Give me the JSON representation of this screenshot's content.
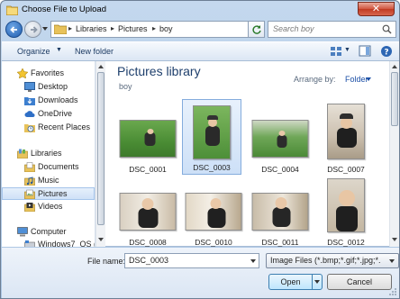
{
  "window": {
    "title": "Choose File to Upload",
    "close_label": "✕"
  },
  "nav": {
    "breadcrumbs": [
      "Libraries",
      "Pictures",
      "boy"
    ],
    "search_placeholder": "Search boy"
  },
  "toolbar": {
    "organize": "Organize",
    "new_folder": "New folder"
  },
  "navpane": {
    "items": [
      {
        "label": "Favorites",
        "icon": "star-icon"
      },
      {
        "label": "Desktop",
        "icon": "desktop-icon"
      },
      {
        "label": "Downloads",
        "icon": "downloads-icon"
      },
      {
        "label": "OneDrive",
        "icon": "cloud-icon"
      },
      {
        "label": "Recent Places",
        "icon": "recent-places-icon"
      },
      {
        "label": "Libraries",
        "icon": "libraries-icon"
      },
      {
        "label": "Documents",
        "icon": "documents-icon"
      },
      {
        "label": "Music",
        "icon": "music-icon"
      },
      {
        "label": "Pictures",
        "icon": "pictures-icon"
      },
      {
        "label": "Videos",
        "icon": "videos-icon"
      },
      {
        "label": "Computer",
        "icon": "computer-icon"
      },
      {
        "label": "Windows7_OS (C",
        "icon": "drive-icon"
      }
    ]
  },
  "main": {
    "library_title": "Pictures library",
    "library_subtitle": "boy",
    "arrange_label": "Arrange by:",
    "arrange_value": "Folder",
    "files": [
      {
        "name": "DSC_0001",
        "selected": false
      },
      {
        "name": "DSC_0003",
        "selected": true
      },
      {
        "name": "DSC_0004",
        "selected": false
      },
      {
        "name": "DSC_0007",
        "selected": false
      },
      {
        "name": "DSC_0008",
        "selected": false
      },
      {
        "name": "DSC_0010",
        "selected": false
      },
      {
        "name": "DSC_0011",
        "selected": false
      },
      {
        "name": "DSC_0012",
        "selected": false
      }
    ]
  },
  "footer": {
    "file_name_label": "File name:",
    "file_name_value": "DSC_0003",
    "filter_value": "Image Files (*.bmp;*.gif;*.jpg;*.",
    "open_label": "Open",
    "cancel_label": "Cancel"
  },
  "colors": {
    "accent": "#1e3f6c",
    "selection": "#cde0f7",
    "title_bar": "#c4d8ee"
  }
}
